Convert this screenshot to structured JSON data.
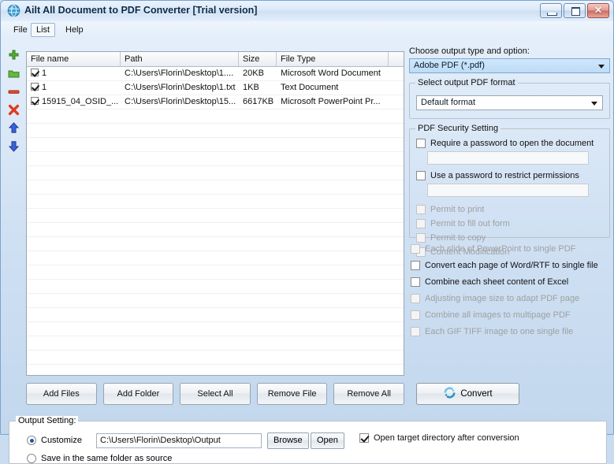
{
  "window": {
    "title": "Ailt All Document to PDF Converter [Trial version]",
    "app_icon": "globe-icon",
    "minimize_label": "",
    "maximize_label": "",
    "close_label": "✕"
  },
  "menubar": {
    "items": [
      {
        "label": "File",
        "selected": false
      },
      {
        "label": "List",
        "selected": true
      },
      {
        "label": "Help",
        "selected": false
      }
    ]
  },
  "left_toolbar": {
    "items": [
      {
        "name": "add-file-icon",
        "tooltip": "Add"
      },
      {
        "name": "add-folder-icon",
        "tooltip": "Add folder"
      },
      {
        "name": "remove-file-icon",
        "tooltip": "Remove"
      },
      {
        "name": "remove-all-icon",
        "tooltip": "Remove all"
      },
      {
        "name": "move-up-icon",
        "tooltip": "Move up"
      },
      {
        "name": "move-down-icon",
        "tooltip": "Move down"
      }
    ]
  },
  "file_table": {
    "columns": [
      "File name",
      "Path",
      "Size",
      "File Type"
    ],
    "rows": [
      {
        "checked": true,
        "name": "1",
        "path": "C:\\Users\\Florin\\Desktop\\1....",
        "size": "20KB",
        "type": "Microsoft Word Document"
      },
      {
        "checked": true,
        "name": "1",
        "path": "C:\\Users\\Florin\\Desktop\\1.txt",
        "size": "1KB",
        "type": "Text Document"
      },
      {
        "checked": true,
        "name": "15915_04_OSID_...",
        "path": "C:\\Users\\Florin\\Desktop\\15...",
        "size": "6617KB",
        "type": "Microsoft PowerPoint Pr..."
      }
    ]
  },
  "action_buttons": [
    {
      "label": "Add Files"
    },
    {
      "label": "Add Folder"
    },
    {
      "label": "Select All"
    },
    {
      "label": "Remove File"
    },
    {
      "label": "Remove All"
    }
  ],
  "convert": {
    "label": "Convert",
    "icon": "refresh-icon"
  },
  "output_options": {
    "type_label": "Choose output type and option:",
    "type_value": "Adobe PDF (*.pdf)",
    "format_group": "Select output PDF format",
    "format_value": "Default format",
    "security_group": "PDF Security Setting",
    "require_password": {
      "label": "Require a password to open the document",
      "checked": false,
      "enabled": true
    },
    "open_password_value": "",
    "restrict_permissions": {
      "label": "Use a password to restrict permissions",
      "checked": false,
      "enabled": true
    },
    "permissions_password_value": "",
    "permits": [
      {
        "label": "Permit to print",
        "checked": false,
        "enabled": false
      },
      {
        "label": "Permit to fill out form",
        "checked": false,
        "enabled": false
      },
      {
        "label": "Permit to copy",
        "checked": false,
        "enabled": false
      },
      {
        "label": "Content Modification",
        "checked": false,
        "enabled": false
      }
    ],
    "conversion_options": [
      {
        "label": "Each slide of PowerPoint to single PDF",
        "checked": false,
        "enabled": false
      },
      {
        "label": "Convert each page of Word/RTF to single file",
        "checked": false,
        "enabled": true
      },
      {
        "label": "Combine each sheet content of Excel",
        "checked": false,
        "enabled": true
      },
      {
        "label": "Adjusting image size to adapt PDF page",
        "checked": false,
        "enabled": false
      },
      {
        "label": "Combine all images to multipage PDF",
        "checked": false,
        "enabled": false
      },
      {
        "label": "Each GIF TIFF image to one single file",
        "checked": false,
        "enabled": false
      }
    ]
  },
  "output_setting": {
    "group_label": "Output Setting:",
    "customize_label": "Customize",
    "customize_selected": true,
    "path_value": "C:\\Users\\Florin\\Desktop\\Output",
    "browse_label": "Browse",
    "open_label": "Open",
    "open_target_label": "Open target directory after conversion",
    "open_target_checked": true,
    "same_folder_label": "Save in the same folder as source",
    "same_folder_selected": false
  },
  "colors": {
    "accent": "#bedcf7",
    "titlebar": "#dbe9f8",
    "add_icon": "#4a9b28",
    "remove_icon": "#d63b2a",
    "arrow_icon": "#2a52c4"
  }
}
